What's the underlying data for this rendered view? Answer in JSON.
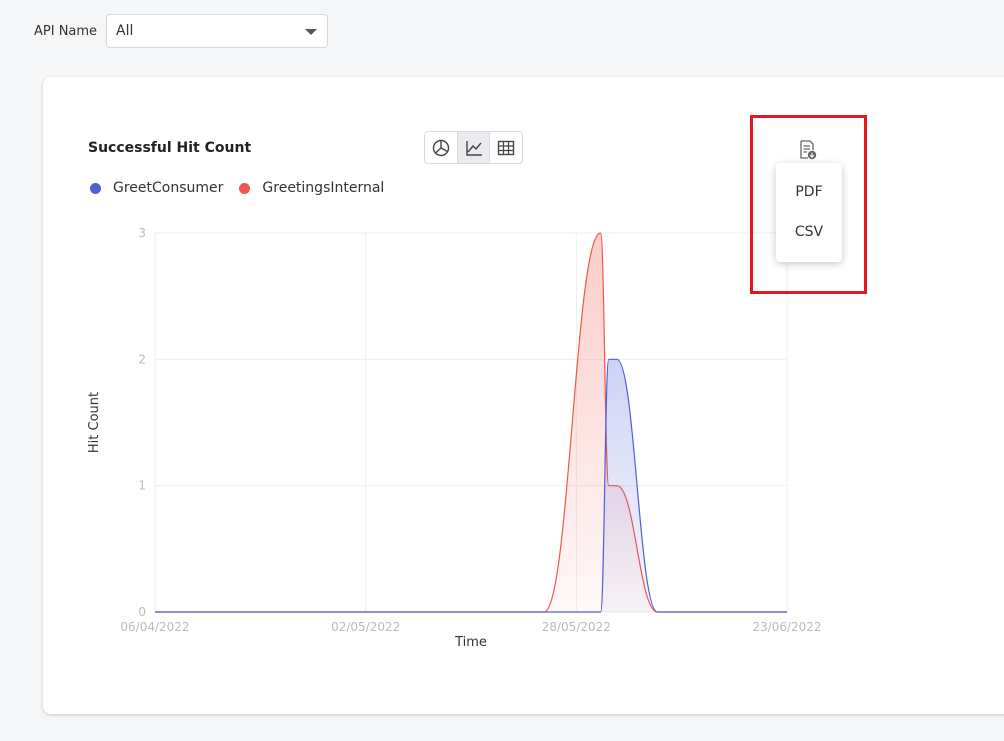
{
  "filter": {
    "label": "API Name",
    "selected": "All"
  },
  "chart": {
    "title": "Successful Hit Count",
    "view_modes": [
      "pie-chart-icon",
      "line-chart-icon",
      "table-grid-icon"
    ],
    "active_view": "line"
  },
  "export_menu": {
    "items": [
      "PDF",
      "CSV"
    ]
  },
  "colors": {
    "GreetConsumer": "#4f5fd5",
    "GreetingsInternal": "#f0574c",
    "highlight": "#e0181f"
  },
  "chart_data": {
    "type": "area",
    "title": "Successful Hit Count",
    "xlabel": "Time",
    "ylabel": "Hit Count",
    "x_ticks": [
      "06/04/2022",
      "02/05/2022",
      "28/05/2022",
      "23/06/2022"
    ],
    "y_ticks": [
      "0",
      "1",
      "2",
      "3"
    ],
    "ylim": [
      0,
      3
    ],
    "grid": true,
    "legend": "top-left",
    "series": [
      {
        "name": "GreetConsumer",
        "points": [
          [
            "06/04/2022",
            0
          ],
          [
            "31/05/2022",
            0
          ],
          [
            "01/06/2022",
            2
          ],
          [
            "02/06/2022",
            2
          ],
          [
            "07/06/2022",
            0
          ],
          [
            "23/06/2022",
            0
          ]
        ]
      },
      {
        "name": "GreetingsInternal",
        "points": [
          [
            "06/04/2022",
            0
          ],
          [
            "24/05/2022",
            0
          ],
          [
            "31/05/2022",
            3
          ],
          [
            "01/06/2022",
            1
          ],
          [
            "02/06/2022",
            1
          ],
          [
            "07/06/2022",
            0
          ],
          [
            "23/06/2022",
            0
          ]
        ]
      }
    ]
  }
}
